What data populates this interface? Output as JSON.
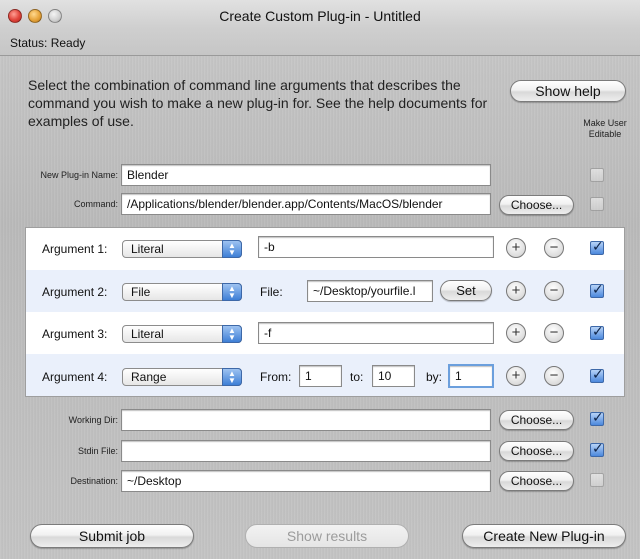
{
  "window": {
    "title": "Create Custom Plug-in - Untitled",
    "status": "Status:  Ready"
  },
  "instruction": "Select the combination of command line arguments that describes the command you wish to make a new plug-in for.  See the help documents for examples of use.",
  "show_help_label": "Show help",
  "make_user_editable_header": "Make User Editable",
  "plugin_name": {
    "label": "New Plug-in Name:",
    "value": "Blender",
    "editable": false
  },
  "command": {
    "label": "Command:",
    "value": "/Applications/blender/blender.app/Contents/MacOS/blender",
    "choose_label": "Choose...",
    "editable": false
  },
  "arguments": [
    {
      "label": "Argument 1:",
      "type": "Literal",
      "value": "-b",
      "editable": true
    },
    {
      "label": "Argument 2:",
      "type": "File",
      "file_label": "File:",
      "value": "~/Desktop/yourfile.l",
      "set_label": "Set",
      "editable": true
    },
    {
      "label": "Argument 3:",
      "type": "Literal",
      "value": "-f",
      "editable": true
    },
    {
      "label": "Argument 4:",
      "type": "Range",
      "from_label": "From:",
      "from": "1",
      "to_label": "to:",
      "to": "10",
      "by_label": "by:",
      "by": "1",
      "editable": true
    }
  ],
  "add_symbol": "+",
  "remove_symbol": "−",
  "working_dir": {
    "label": "Working Dir:",
    "value": "",
    "choose_label": "Choose...",
    "editable": true
  },
  "stdin_file": {
    "label": "Stdin File:",
    "value": "",
    "choose_label": "Choose...",
    "editable": true
  },
  "destination": {
    "label": "Destination:",
    "value": "~/Desktop",
    "choose_label": "Choose...",
    "editable": false
  },
  "footer": {
    "submit_label": "Submit job",
    "show_results_label": "Show results",
    "create_label": "Create New Plug-in"
  }
}
